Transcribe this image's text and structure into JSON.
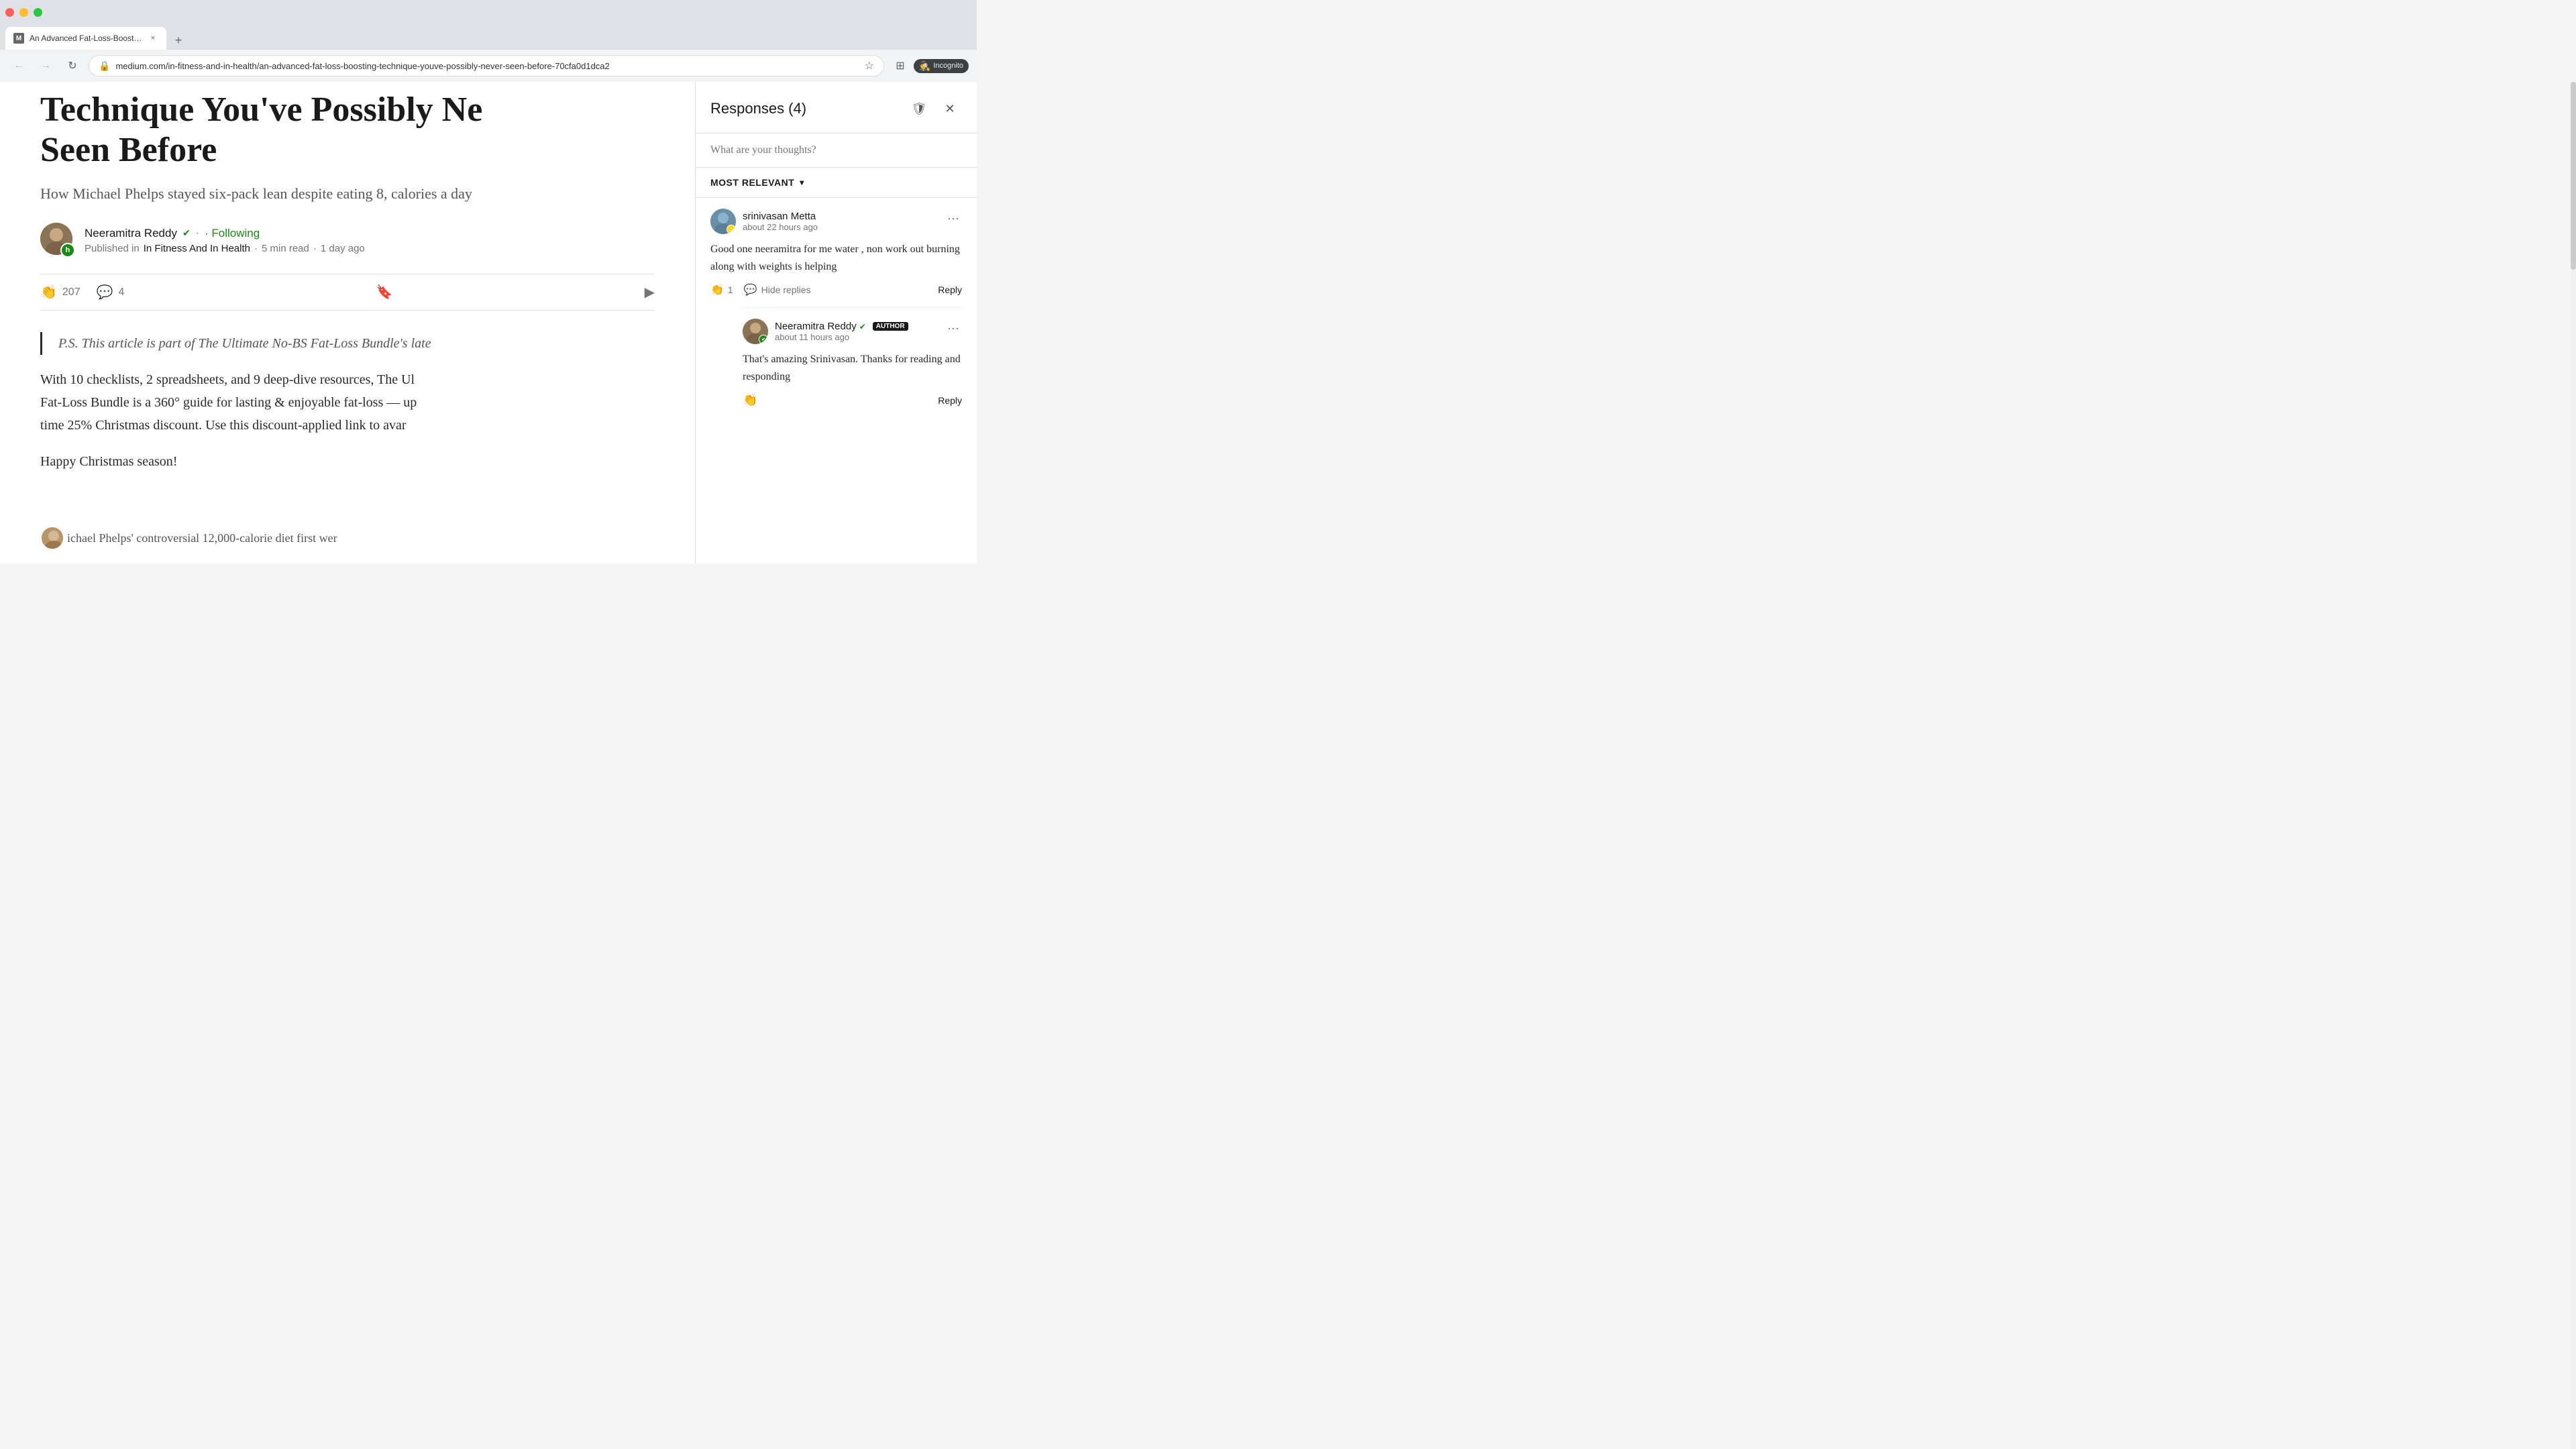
{
  "browser": {
    "tab": {
      "favicon": "M",
      "title": "An Advanced Fat-Loss-Boosting...",
      "close_label": "×"
    },
    "new_tab_label": "+",
    "address": "medium.com/in-fitness-and-in-health/an-advanced-fat-loss-boosting-technique-youve-possibly-never-seen-before-70cfa0d1dca2",
    "back_label": "←",
    "forward_label": "→",
    "reload_label": "↻",
    "star_label": "☆",
    "incognito_label": "Incognito"
  },
  "article": {
    "title_part1": "Technique You've Possibly Ne",
    "title_part2": "Seen Before",
    "subtitle": "How Michael Phelps stayed six-pack lean despite eating 8,",
    "subtitle2": "calories a day",
    "author_name": "Neeramitra Reddy",
    "follow_label": "· Following",
    "published_in": "Published in",
    "publication": "In Fitness And In Health",
    "read_time": "5 min read",
    "time_ago": "1 day ago",
    "clap_count": "207",
    "comment_count": "4",
    "body_blockquote": "P.S. This article is part of The Ultimate No-BS Fat-Loss Bundle's late",
    "body_p1": "With 10 checklists, 2 spreadsheets, and 9 deep-dive resources, The Ul",
    "body_p2_part": "Fat-Loss Bundle is a 360° guide for lasting & enjoyable fat-loss — up",
    "body_p3": "time 25% Christmas discount. Use this discount-applied link to avar",
    "body_p4": "Happy Christmas season!",
    "body_note": "ichael Phelps' controversial 12,000-calorie diet first wer"
  },
  "responses_panel": {
    "title": "Responses (4)",
    "shield_label": "🛡",
    "close_label": "×",
    "input_placeholder": "What are your thoughts?",
    "sort_label": "MOST RELEVANT",
    "sort_icon": "▾",
    "responses": [
      {
        "id": "r1",
        "username": "srinivasan Metta",
        "time": "about 22 hours ago",
        "text": "Good one neeramitra for me water , non work out burning along with weights is helping",
        "clap_count": "1",
        "hide_replies_label": "Hide replies",
        "reply_label": "Reply",
        "has_star": true,
        "replies": [
          {
            "id": "r1-reply1",
            "username": "Neeramitra Reddy",
            "verified": true,
            "author_badge": "AUTHOR",
            "time": "about 11 hours ago",
            "text": "That's amazing Srinivasan. Thanks for reading and responding",
            "reply_label": "Reply",
            "has_green_badge": true
          }
        ]
      }
    ]
  }
}
